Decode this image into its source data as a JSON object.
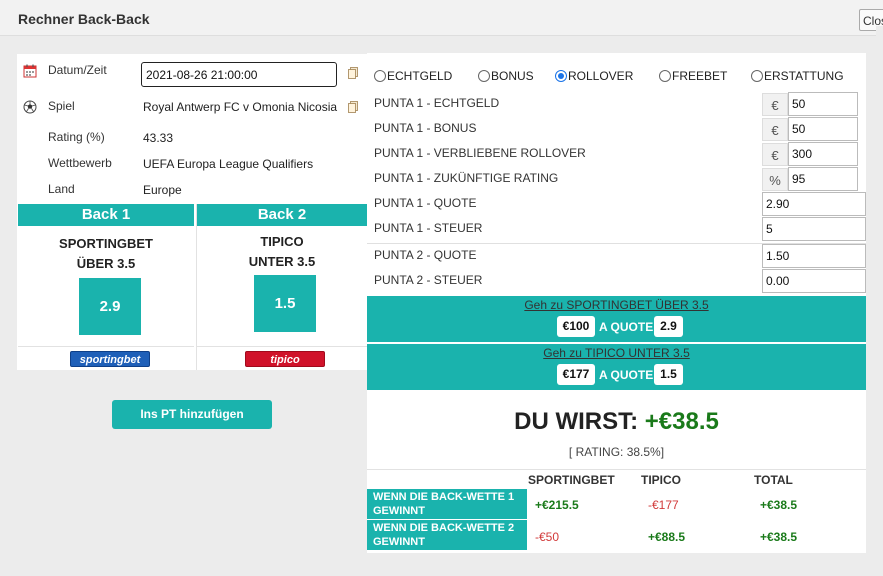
{
  "window": {
    "title": "Rechner Back-Back",
    "close_label": "Close"
  },
  "event": {
    "date_label": "Datum/Zeit",
    "date_value": "2021-08-26 21:00:00",
    "match_label": "Spiel",
    "match_value": "Royal Antwerp FC v Omonia Nicosia",
    "rating_label": "Rating (%)",
    "rating_value": "43.33",
    "competition_label": "Wettbewerb",
    "competition_value": "UEFA Europa League Qualifiers",
    "country_label": "Land",
    "country_value": "Europe"
  },
  "back1": {
    "header": "Back 1",
    "bookmaker": "SPORTINGBET",
    "market": "ÜBER 3.5",
    "odds": "2.9",
    "logo_text": "sportingbet"
  },
  "back2": {
    "header": "Back 2",
    "bookmaker": "TIPICO",
    "market": "UNTER 3.5",
    "odds": "1.5",
    "logo_text": "tipico"
  },
  "add_button_label": "Ins PT hinzufügen",
  "bet_types": [
    {
      "label": "ECHTGELD",
      "selected": false
    },
    {
      "label": "BONUS",
      "selected": false
    },
    {
      "label": "ROLLOVER",
      "selected": true
    },
    {
      "label": "FREEBET",
      "selected": false
    },
    {
      "label": "ERSTATTUNG",
      "selected": false
    }
  ],
  "fields": [
    {
      "label": "PUNTA 1 - ECHTGELD",
      "unit": "€",
      "value": "50"
    },
    {
      "label": "PUNTA 1 - BONUS",
      "unit": "€",
      "value": "50"
    },
    {
      "label": "PUNTA 1 - VERBLIEBENE ROLLOVER",
      "unit": "€",
      "value": "300"
    },
    {
      "label": "PUNTA 1 - ZUKÜNFTIGE RATING",
      "unit": "%",
      "value": "95"
    },
    {
      "label": "PUNTA 1 - QUOTE",
      "unit": "",
      "value": "2.90"
    },
    {
      "label": "PUNTA 1 - STEUER",
      "unit": "",
      "value": "5"
    },
    {
      "label": "PUNTA 2  - QUOTE",
      "unit": "",
      "value": "1.50"
    },
    {
      "label": "PUNTA 2 - STEUER",
      "unit": "",
      "value": "0.00"
    }
  ],
  "goto": [
    {
      "link": "Geh zu SPORTINGBET ÜBER 3.5",
      "stake": "€100",
      "a_quote": "A QUOTE",
      "odds": "2.9"
    },
    {
      "link": "Geh zu TIPICO UNTER 3.5",
      "stake": "€177",
      "a_quote": "A QUOTE",
      "odds": "1.5"
    }
  ],
  "result": {
    "label": "DU WIRST:",
    "amount": "+€38.5",
    "rating": "[ RATING: 38.5%]"
  },
  "table": {
    "headers": [
      "SPORTINGBET",
      "TIPICO",
      "TOTAL"
    ],
    "rows": [
      {
        "label": "WENN DIE BACK-WETTE 1 GEWINNT",
        "sportingbet": "+€215.5",
        "tipico": "-€177",
        "total": "+€38.5"
      },
      {
        "label": "WENN DIE BACK-WETTE 2 GEWINNT",
        "sportingbet": "-€50",
        "tipico": "+€88.5",
        "total": "+€38.5"
      }
    ]
  },
  "colors": {
    "accent": "#1ab3ad",
    "positive": "#1a7a1a",
    "negative": "#d23a3a",
    "radio_selected": "#1a73e8"
  }
}
